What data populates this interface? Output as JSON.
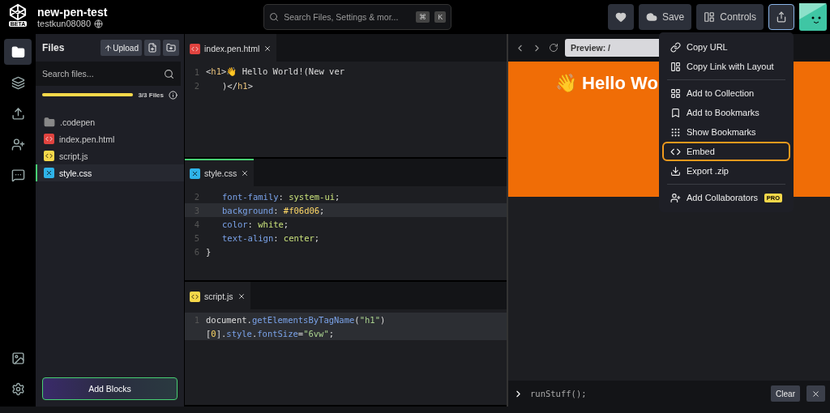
{
  "header": {
    "title": "new-pen-test",
    "user": "testkun08080",
    "logo_badge": "BETA",
    "search": {
      "placeholder": "Search Files, Settings & mor...",
      "keys": [
        "⌘",
        "K"
      ]
    },
    "buttons": [
      {
        "kind": "heart"
      },
      {
        "kind": "cloud",
        "label": "Save"
      },
      {
        "kind": "layout",
        "label": "Controls"
      },
      {
        "kind": "share",
        "selected": true
      }
    ]
  },
  "rail": {
    "top": [
      {
        "kind": "folder",
        "selected": true
      },
      {
        "kind": "layers",
        "selected": false
      },
      {
        "kind": "upload",
        "selected": false
      },
      {
        "kind": "user",
        "selected": false
      },
      {
        "kind": "chat",
        "selected": false
      }
    ],
    "bottom": [
      {
        "kind": "image",
        "selected": false
      },
      {
        "kind": "settings",
        "selected": false
      }
    ]
  },
  "files": {
    "title": "Files",
    "upload": "Upload",
    "search": {
      "placeholder": "Search files..."
    },
    "progress": {
      "level": 1,
      "label": "3/3 Files"
    },
    "items": [
      {
        "kind": "folder",
        "name": ".codepen",
        "selected": false
      },
      {
        "kind": "html",
        "name": "index.pen.html",
        "selected": false
      },
      {
        "kind": "js",
        "name": "script.js",
        "selected": false
      },
      {
        "kind": "css",
        "name": "style.css",
        "selected": true
      }
    ],
    "add_blocks": "Add Blocks"
  },
  "editors": [
    {
      "kind": "html",
      "tab": "index.pen.html",
      "selected": false,
      "lines": [
        {
          "num": "1",
          "active": false,
          "indented": false,
          "tokens": [
            {
              "kind": "punct",
              "s": "<"
            },
            {
              "kind": "tag",
              "s": "h1"
            },
            {
              "kind": "punct",
              "s": ">👋 Hello World!(New ver"
            }
          ]
        },
        {
          "num": "2",
          "active": false,
          "indented": true,
          "tokens": [
            {
              "kind": "punct",
              "s": ")</"
            },
            {
              "kind": "tag",
              "s": "h1"
            },
            {
              "kind": "punct",
              "s": ">"
            }
          ]
        }
      ]
    },
    {
      "kind": "css",
      "tab": "style.css",
      "selected": true,
      "lines": [
        {
          "num": "2",
          "active": false,
          "indented": true,
          "tokens": [
            {
              "kind": "prop",
              "s": "font-family"
            },
            {
              "kind": "punct",
              "s": ":"
            },
            {
              "kind": "value",
              "s": "system-ui"
            },
            {
              "kind": "punct",
              "s": ";"
            }
          ]
        },
        {
          "num": "3",
          "active": true,
          "indented": true,
          "tokens": [
            {
              "kind": "prop",
              "s": "background"
            },
            {
              "kind": "punct",
              "s": ":"
            },
            {
              "kind": "hex",
              "s": "#f06d06"
            },
            {
              "kind": "punct",
              "s": ";"
            }
          ]
        },
        {
          "num": "4",
          "active": false,
          "indented": true,
          "tokens": [
            {
              "kind": "prop",
              "s": "color"
            },
            {
              "kind": "punct",
              "s": ":"
            },
            {
              "kind": "value",
              "s": "white"
            },
            {
              "kind": "punct",
              "s": ";"
            }
          ]
        },
        {
          "num": "5",
          "active": false,
          "indented": true,
          "tokens": [
            {
              "kind": "prop",
              "s": "text-align"
            },
            {
              "kind": "punct",
              "s": ":"
            },
            {
              "kind": "value",
              "s": "center"
            },
            {
              "kind": "punct",
              "s": ";"
            }
          ]
        },
        {
          "num": "6",
          "active": false,
          "indented": false,
          "tokens": [
            {
              "kind": "punct",
              "s": "}"
            }
          ]
        }
      ]
    },
    {
      "kind": "js",
      "tab": "script.js",
      "selected": false,
      "lines": [
        {
          "num": "1",
          "active": true,
          "indented": false,
          "tokens": [
            {
              "kind": "punct",
              "s": "document."
            },
            {
              "kind": "prop",
              "s": "getElementsByTagName"
            },
            {
              "kind": "punct",
              "s": "("
            },
            {
              "kind": "str",
              "s": "\"h1\""
            },
            {
              "kind": "punct",
              "s": ")"
            }
          ]
        },
        {
          "active": true,
          "indented": false,
          "tokens": [
            {
              "kind": "punct",
              "s": "["
            },
            {
              "kind": "hex",
              "s": "0"
            },
            {
              "kind": "punct",
              "s": "]."
            },
            {
              "kind": "prop",
              "s": "style"
            },
            {
              "kind": "punct",
              "s": "."
            },
            {
              "kind": "prop",
              "s": "fontSize"
            },
            {
              "kind": "punct",
              "s": "="
            },
            {
              "kind": "str",
              "s": "\"6vw\""
            },
            {
              "kind": "punct",
              "s": ";"
            }
          ]
        }
      ]
    }
  ],
  "preview": {
    "address": "Preview: /",
    "heading": "👋 Hello Wo",
    "console": {
      "input": "runStuff();",
      "clear": "Clear"
    }
  },
  "menu": {
    "items": [
      {
        "kind": "link",
        "label": "Copy URL",
        "highlighted": false,
        "divider_after": false
      },
      {
        "kind": "layout",
        "label": "Copy Link with Layout",
        "highlighted": false,
        "divider_after": true
      },
      {
        "kind": "grid",
        "label": "Add to Collection",
        "highlighted": false,
        "divider_after": false
      },
      {
        "kind": "bookmark",
        "label": "Add to Bookmarks",
        "highlighted": false,
        "divider_after": false
      },
      {
        "kind": "dots",
        "label": "Show Bookmarks",
        "highlighted": false,
        "divider_after": false
      },
      {
        "kind": "code",
        "label": "Embed",
        "highlighted": true,
        "divider_after": false
      },
      {
        "kind": "download",
        "label": "Export .zip",
        "highlighted": false,
        "divider_after": true
      },
      {
        "kind": "user",
        "label": "Add Collaborators",
        "badge": "PRO",
        "highlighted": false,
        "divider_after": false
      }
    ]
  }
}
